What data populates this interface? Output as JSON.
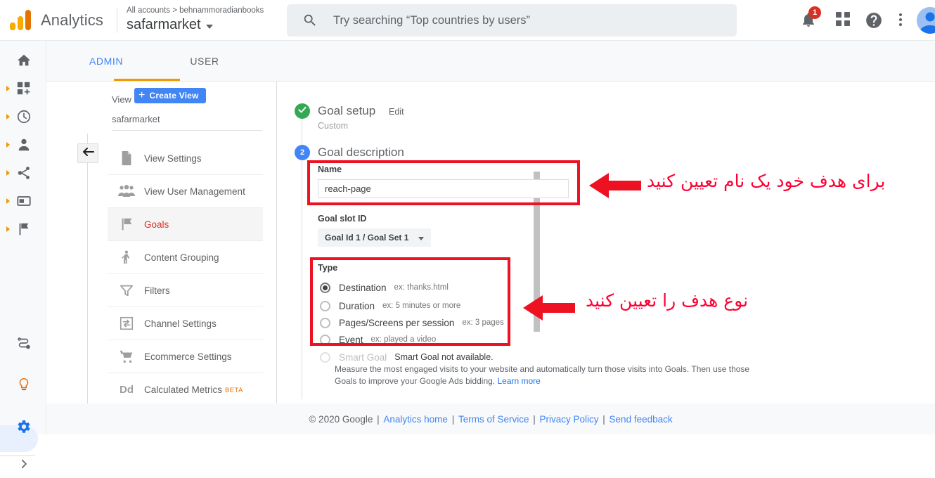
{
  "topbar": {
    "brand": "Analytics",
    "breadcrumb": "All accounts > behnammoradianbooks",
    "account": "safarmarket",
    "search_placeholder": "Try searching “Top countries by users”",
    "notification_count": "1",
    "icons": {
      "logo": "analytics-logo",
      "search": "search-icon",
      "bell": "notifications-bell-icon",
      "apps": "apps-grid-icon",
      "help": "help-circle-icon",
      "more": "more-vertical-icon",
      "avatar": "account-avatar"
    }
  },
  "rail": {
    "items": [
      {
        "name": "home",
        "icon": "home-icon",
        "expandable": false
      },
      {
        "name": "customization",
        "icon": "dashboard-add-icon",
        "expandable": true
      },
      {
        "name": "realtime",
        "icon": "clock-icon",
        "expandable": true
      },
      {
        "name": "audience",
        "icon": "person-icon",
        "expandable": true
      },
      {
        "name": "acquisition",
        "icon": "share-nodes-icon",
        "expandable": true
      },
      {
        "name": "behavior",
        "icon": "card-icon",
        "expandable": true
      },
      {
        "name": "conversions",
        "icon": "flag-icon",
        "expandable": true
      }
    ],
    "bottom_items": [
      {
        "name": "attribution",
        "icon": "attribution-path-icon"
      },
      {
        "name": "discover",
        "icon": "lightbulb-icon"
      },
      {
        "name": "admin",
        "icon": "gear-icon",
        "selected": true
      },
      {
        "name": "expand",
        "icon": "chevron-right-icon"
      }
    ]
  },
  "tabs": [
    {
      "label": "ADMIN",
      "active": true
    },
    {
      "label": "USER",
      "active": false
    }
  ],
  "view_column": {
    "section_label": "View",
    "create_button": "Create View",
    "view_name": "safarmarket",
    "collapse_icon": "arrow-left-icon",
    "items": [
      {
        "label": "View Settings",
        "icon": "document-icon",
        "active": false
      },
      {
        "label": "View User Management",
        "icon": "people-icon",
        "active": false
      },
      {
        "label": "Goals",
        "icon": "flag-icon",
        "active": true
      },
      {
        "label": "Content Grouping",
        "icon": "content-grouping-icon",
        "active": false
      },
      {
        "label": "Filters",
        "icon": "funnel-icon",
        "active": false
      },
      {
        "label": "Channel Settings",
        "icon": "channel-settings-icon",
        "active": false
      },
      {
        "label": "Ecommerce Settings",
        "icon": "shopping-cart-icon",
        "active": false
      },
      {
        "label": "Calculated Metrics",
        "icon": "dd-icon",
        "badge": "BETA",
        "active": false
      }
    ]
  },
  "form": {
    "step1": {
      "badge_icon": "check-icon",
      "title": "Goal setup",
      "edit_link": "Edit",
      "subtitle": "Custom"
    },
    "step2": {
      "badge_number": "2",
      "title": "Goal description"
    },
    "name_label": "Name",
    "name_value": "reach-page",
    "slot_label": "Goal slot ID",
    "slot_value": "Goal Id 1 / Goal Set 1",
    "type_label": "Type",
    "type_options": [
      {
        "label": "Destination",
        "example": "ex: thanks.html",
        "checked": true,
        "disabled": false
      },
      {
        "label": "Duration",
        "example": "ex: 5 minutes or more",
        "checked": false,
        "disabled": false
      },
      {
        "label": "Pages/Screens per session",
        "example": "ex: 3 pages",
        "checked": false,
        "disabled": false
      },
      {
        "label": "Event",
        "example": "ex: played a video",
        "checked": false,
        "disabled": false
      },
      {
        "label": "Smart Goal",
        "example": "Smart Goal not available.",
        "checked": false,
        "disabled": true
      }
    ],
    "smart_goal_description": "Measure the most engaged visits to your website and automatically turn those visits into Goals. Then use those Goals to improve your Google Ads bidding.",
    "smart_goal_learn_more": "Learn more"
  },
  "annotations": {
    "accent_color": "#ff0033",
    "note_name": "برای هدف خود یک نام تعیین کنید",
    "note_type": "نوع هدف را تعیین کنید"
  },
  "footer": {
    "copyright": "© 2020 Google",
    "links": [
      "Analytics home",
      "Terms of Service",
      "Privacy Policy",
      "Send feedback"
    ]
  },
  "colors": {
    "blue": "#4285f4",
    "orange": "#f29900",
    "green": "#34a853",
    "red_annotation": "#ee1122",
    "goals_red": "#d93025"
  }
}
